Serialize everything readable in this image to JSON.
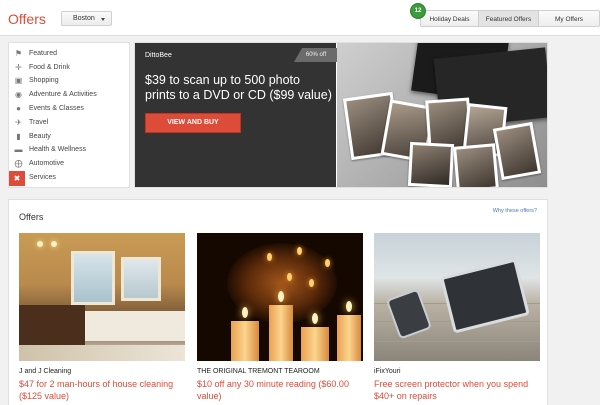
{
  "header": {
    "title": "Offers",
    "city": "Boston",
    "badge_count": "12",
    "tabs": [
      {
        "label": "Holiday Deals"
      },
      {
        "label": "Featured Offers"
      },
      {
        "label": "My Offers"
      }
    ]
  },
  "sidebar": {
    "items": [
      {
        "label": "Featured",
        "icon": "tag-icon"
      },
      {
        "label": "Food & Drink",
        "icon": "fork-knife-icon"
      },
      {
        "label": "Shopping",
        "icon": "cart-icon"
      },
      {
        "label": "Adventure & Activities",
        "icon": "bicycle-icon"
      },
      {
        "label": "Events & Classes",
        "icon": "people-icon"
      },
      {
        "label": "Travel",
        "icon": "plane-icon"
      },
      {
        "label": "Beauty",
        "icon": "lipstick-icon"
      },
      {
        "label": "Health & Wellness",
        "icon": "dumbbell-icon"
      },
      {
        "label": "Automotive",
        "icon": "steering-wheel-icon"
      },
      {
        "label": "Services",
        "icon": "tools-icon"
      }
    ],
    "selected": "Services"
  },
  "hero": {
    "brand": "DittoBee",
    "discount": "60% off",
    "headline": "$39 to scan up to 500 photo prints to a DVD or CD ($99 value)",
    "button": "VIEW AND BUY"
  },
  "offers": {
    "title": "Offers",
    "why_link": "Why these offers?",
    "cards": [
      {
        "merchant": "J and J Cleaning",
        "desc": "$47 for 2 man-hours of house cleaning ($125 value)"
      },
      {
        "merchant": "THE ORIGINAL TREMONT TEAROOM",
        "desc": "$10 off any 30 minute reading ($60.00 value)"
      },
      {
        "merchant": "iFixYouri",
        "desc": "Free screen protector when you spend $40+ on repairs"
      }
    ]
  },
  "colors": {
    "accent": "#dd4b39",
    "badge": "#3c9b3c",
    "link": "#4a78c6"
  }
}
